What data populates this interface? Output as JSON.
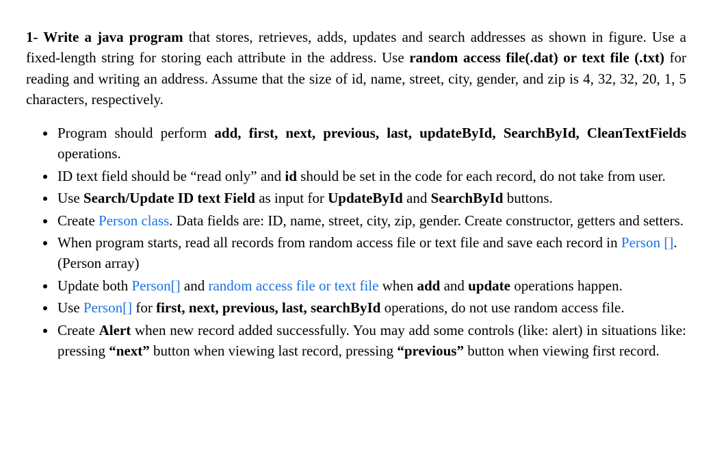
{
  "intro": {
    "q_number": "1- ",
    "lead": "Write a java program",
    "body1": " that stores, retrieves, adds, updates and search addresses as shown in figure. Use a fixed-length string for storing each attribute in the address. Use ",
    "bold2": "random access file(.dat) or text file (.txt)",
    "body2": " for reading and writing an address. Assume that the size of id, name, street, city, gender, and zip is 4, 32, 32, 20, 1, 5 characters, respectively."
  },
  "bullets": {
    "b1": {
      "t1": "Program should perform ",
      "bold": "add, first, next, previous, last, updateById, SearchById, CleanTextFields",
      "t2": " operations."
    },
    "b2": {
      "t1": "ID text field should be “read only” and ",
      "bold": "id",
      "t2": " should be set in the code for each record, do not take from user."
    },
    "b3": {
      "t1": "Use ",
      "bold1": "Search/Update ID text Field",
      "t2": " as input for ",
      "bold2": "UpdateById",
      "t3": " and ",
      "bold3": "SearchById",
      "t4": " buttons."
    },
    "b4": {
      "t1": "Create ",
      "link": "Person class",
      "t2": ". Data fields are: ID, name, street, city, zip, gender. Create constructor, getters and setters."
    },
    "b5": {
      "t1": "When program starts, read all records from random access file or text file and save each record in ",
      "link": "Person []",
      "t2": ". (Person array)"
    },
    "b6": {
      "t1": "Update both ",
      "link1": "Person[]",
      "t2": " and ",
      "link2": "random access file or text file",
      "t3": " when ",
      "bold1": "add",
      "t4": " and ",
      "bold2": "update",
      "t5": " operations happen."
    },
    "b7": {
      "t1": "Use ",
      "link": "Person[]",
      "t2": " for ",
      "bold": "first, next, previous, last, searchById",
      "t3": " operations, do not use random access file."
    },
    "b8": {
      "t1": "Create ",
      "bold1": "Alert",
      "t2": " when new record added successfully. You may add some controls (like: alert) in situations like: pressing ",
      "bold2": "“next”",
      "t3": " button when viewing last record, pressing ",
      "bold3": "“previous”",
      "t4": " button when viewing first record."
    }
  }
}
